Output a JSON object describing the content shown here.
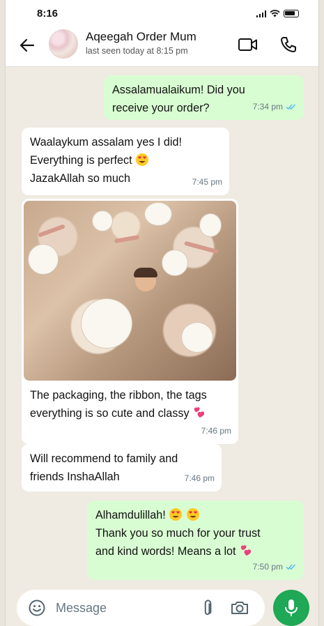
{
  "status_bar": {
    "time": "8:16"
  },
  "header": {
    "contact_name": "Aqeegah Order Mum",
    "last_seen": "last seen today at 8:15 pm",
    "icons": [
      "back-arrow-icon",
      "video-call-icon",
      "phone-call-icon"
    ]
  },
  "messages": [
    {
      "direction": "outgoing",
      "lines": [
        "Assalamualaikum! Did you",
        "receive your order?"
      ],
      "time": "7:34 pm",
      "status": "read"
    },
    {
      "direction": "incoming",
      "lines": [
        "Waalaykum assalam yes I did!",
        "Everything is perfect",
        "JazakAllah so much"
      ],
      "time": "7:45 pm"
    },
    {
      "direction": "incoming",
      "type": "image",
      "lines": [
        "The packaging, the ribbon, the tags",
        "everything is so cute and classy"
      ],
      "time": "7:46 pm"
    },
    {
      "direction": "incoming",
      "lines": [
        "Will recommend to family and",
        "friends InshaAllah"
      ],
      "time": "7:46 pm"
    },
    {
      "direction": "outgoing",
      "lines": [
        "Alhamdulillah!",
        "Thank you so much for your trust",
        "and kind words! Means a lot"
      ],
      "time": "7:50 pm",
      "status": "read"
    }
  ],
  "composer": {
    "placeholder": "Message"
  },
  "colors": {
    "outgoing_bubble": "#d9fdd3",
    "incoming_bubble": "#ffffff",
    "accent_green": "#1fa855",
    "read_ticks": "#53bdeb",
    "chat_background": "#efeae2"
  }
}
